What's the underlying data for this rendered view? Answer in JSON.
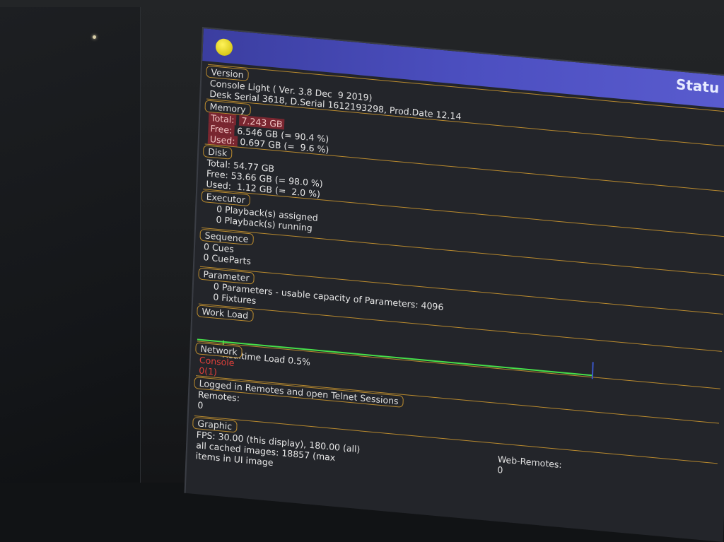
{
  "titlebar": {
    "title": "Statu"
  },
  "version": {
    "header": "Version",
    "line1": "Console Light ( Ver. 3.8 Dec  9 2019)",
    "line2": "Desk Serial 3618, D.Serial 1612193298, Prod.Date 12.14"
  },
  "memory": {
    "header": "Memory",
    "total_label": "Total:",
    "total_value": "7.243 GB",
    "free_label": "Free:",
    "free_value": "6.546 GB (= 90.4 %)",
    "used_label": "Used:",
    "used_value": "0.697 GB (=  9.6 %)"
  },
  "disk": {
    "header": "Disk",
    "total_label": "Total:",
    "total_value": "54.77 GB",
    "free_label": "Free:",
    "free_value": "53.66 GB (= 98.0 %)",
    "used_label": "Used:",
    "used_value": " 1.12 GB (=  2.0 %)"
  },
  "executor": {
    "header": "Executor",
    "line1": "0 Playback(s) assigned",
    "line2": "0 Playback(s) running"
  },
  "sequence": {
    "header": "Sequence",
    "line1": "0 Cues",
    "line2": "0 CueParts"
  },
  "parameter": {
    "header": "Parameter",
    "line1": "0 Parameters - usable capacity of Parameters: 4096",
    "line2": "0 Fixtures"
  },
  "workload": {
    "header": "Work Load",
    "realtime_label": "Realtime Load 0.5%",
    "realtime_fraction": 0.005
  },
  "network": {
    "header": "Network",
    "console_label": "Console",
    "console_value": "0(1)"
  },
  "remotes": {
    "header": "Logged in Remotes and open Telnet Sessions",
    "remotes_label": "Remotes:",
    "remotes_value": "0",
    "web_label": "Web-Remotes:",
    "web_value": "0"
  },
  "graphic": {
    "header": "Graphic",
    "fps": "FPS: 30.00 (this display), 180.00 (all)",
    "cached": "all cached images: 18857 (max",
    "items": "items in UI image"
  },
  "colors": {
    "section_border": "#b98a2e",
    "titlebar": "#4c4fc0",
    "load_bar": "#46e04a",
    "alert_red": "#e0403a"
  }
}
